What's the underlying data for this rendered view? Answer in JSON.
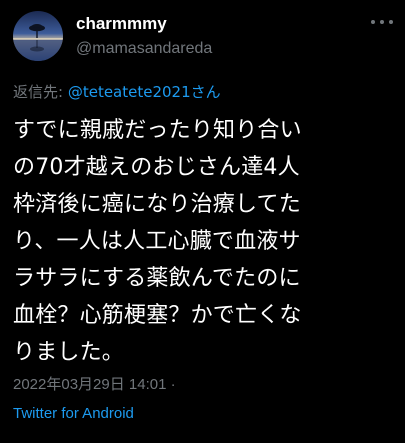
{
  "author": {
    "display_name": "charmmmy",
    "handle": "@mamasandareda"
  },
  "reply_to": {
    "label": "返信先: ",
    "mention": "@teteatete2021さん"
  },
  "tweet": {
    "lines": [
      "すでに親戚だったり知り合い",
      "の70才越えのおじさん達4人",
      "枠済後に癌になり治療してた",
      "り、一人は人工心臓で血液サ",
      "ラサラにする薬飲んでたのに",
      "血栓？心筋梗塞？かで亡くな",
      "りました。"
    ]
  },
  "meta": {
    "timestamp": "2022年03月29日 14:01 ·",
    "source": "Twitter for Android"
  },
  "colors": {
    "background": "#000000",
    "text": "#ffffff",
    "muted": "#71767b",
    "link": "#1d9bf0"
  },
  "icons": {
    "avatar": "avatar-landscape-tree",
    "more": "more-dots-icon"
  }
}
